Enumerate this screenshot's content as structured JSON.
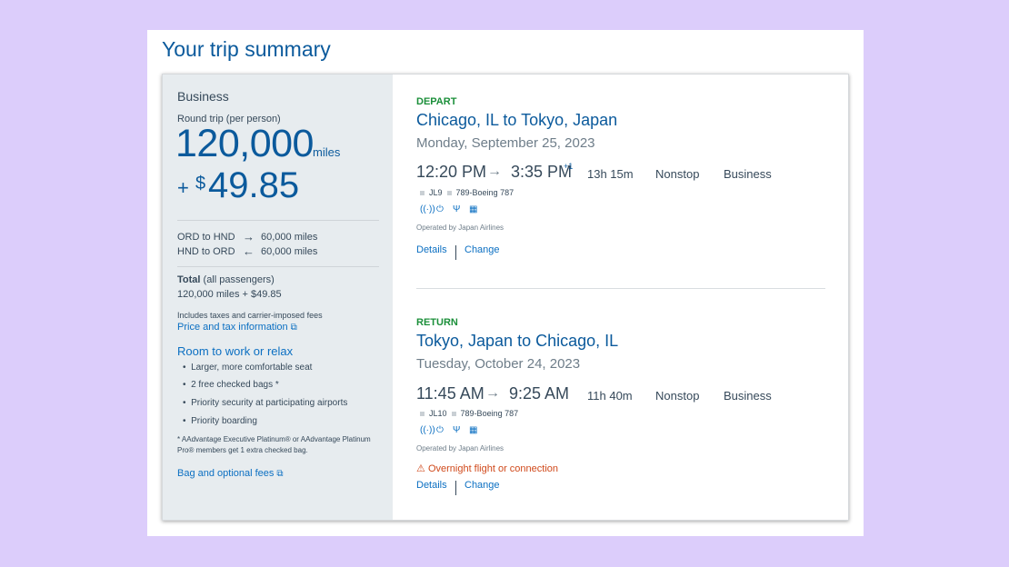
{
  "title": "Your trip summary",
  "summary": {
    "cabin": "Business",
    "round_trip_label": "Round trip (per person)",
    "miles": "120,000",
    "miles_unit": "miles",
    "plus": "+",
    "currency": "$",
    "amount": "49.85",
    "segments": [
      {
        "route": "ORD to HND",
        "arrow": "→",
        "miles": "60,000 miles"
      },
      {
        "route": "HND to ORD",
        "arrow": "←",
        "miles": "60,000 miles"
      }
    ],
    "total_label": "Total",
    "total_suffix": "(all passengers)",
    "total_value": "120,000 miles + $49.85",
    "includes": "Includes taxes and carrier-imposed fees",
    "price_link": "Price and tax information",
    "perks_title": "Room to work or relax",
    "perks": [
      "Larger, more comfortable seat",
      "2 free checked bags *",
      "Priority security at participating airports",
      "Priority boarding"
    ],
    "footnote": "* AAdvantage Executive Platinum® or AAdvantage Platinum Pro® members get 1 extra checked bag.",
    "bag_link": "Bag and optional fees",
    "external_icon": "external-link-icon"
  },
  "depart": {
    "label": "DEPART",
    "route": "Chicago, IL to Tokyo, Japan",
    "date": "Monday, September 25, 2023",
    "dep_time": "12:20 PM",
    "arr_time": "3:35 PM",
    "day_offset": "+1",
    "duration": "13h 15m",
    "stops": "Nonstop",
    "cabin": "Business",
    "flight": "JL9",
    "aircraft": "789-Boeing 787",
    "operated": "Operated by Japan Airlines",
    "details": "Details",
    "change": "Change"
  },
  "return": {
    "label": "RETURN",
    "route": "Tokyo, Japan to Chicago, IL",
    "date": "Tuesday, October 24, 2023",
    "dep_time": "11:45 AM",
    "arr_time": "9:25 AM",
    "duration": "11h 40m",
    "stops": "Nonstop",
    "cabin": "Business",
    "flight": "JL10",
    "aircraft": "789-Boeing 787",
    "operated": "Operated by Japan Airlines",
    "warning": "Overnight flight or connection",
    "details": "Details",
    "change": "Change"
  },
  "amenities": [
    "wifi-icon",
    "power-icon",
    "usb-icon",
    "entertainment-icon"
  ],
  "colors": {
    "background": "#dccdfb",
    "primary": "#0b5a9c",
    "green": "#1b8f3a",
    "warning": "#d0491b",
    "side": "#e7ecef"
  }
}
